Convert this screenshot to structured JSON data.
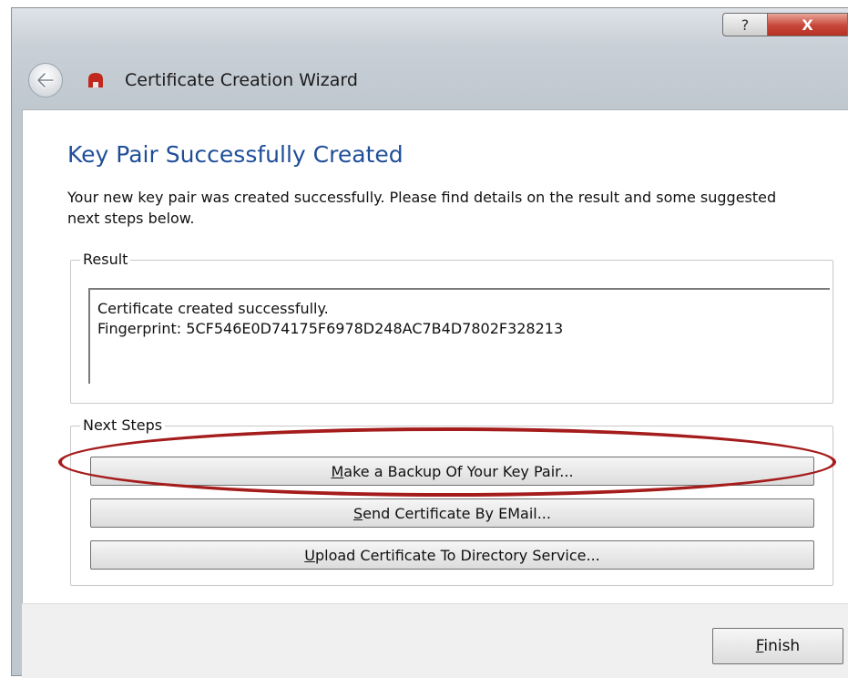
{
  "window": {
    "title": "Certificate Creation Wizard",
    "help_label": "?",
    "close_label": "X",
    "icon": "certificate-wizard-icon"
  },
  "page": {
    "heading": "Key Pair Successfully Created",
    "description": "Your new key pair was created successfully. Please find details on the result and some suggested next steps below."
  },
  "result": {
    "label": "Result",
    "line1": "Certificate created successfully.",
    "line2": "Fingerprint: 5CF546E0D74175F6978D248AC7B4D7802F328213"
  },
  "next_steps": {
    "label": "Next Steps",
    "buttons": [
      {
        "accel": "M",
        "rest": "ake a Backup Of Your Key Pair..."
      },
      {
        "accel": "S",
        "rest": "end Certificate By EMail..."
      },
      {
        "accel": "U",
        "rest": "pload Certificate To Directory Service..."
      }
    ]
  },
  "footer": {
    "finish_accel": "F",
    "finish_rest": "inish"
  },
  "colors": {
    "heading": "#1f4e99",
    "highlight": "#a51c1c",
    "close_button": "#c6463a"
  }
}
